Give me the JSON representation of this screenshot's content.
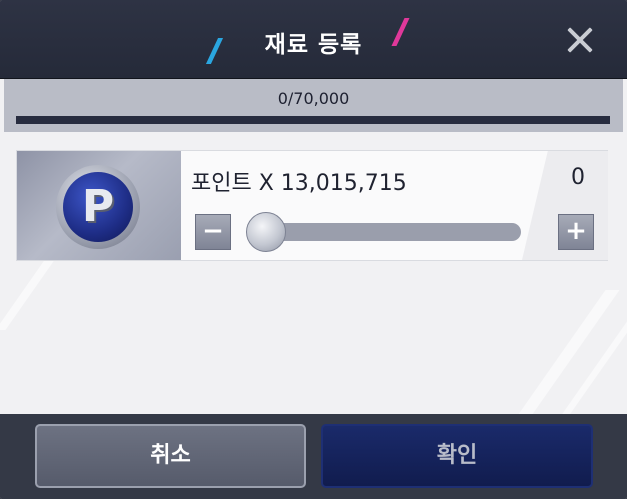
{
  "dialog": {
    "title": "재료 등록",
    "close_icon": "close-icon"
  },
  "capacity": {
    "count_text": "0/70,000",
    "fill": 0
  },
  "item": {
    "icon": "point-coin-icon",
    "icon_letter": "P",
    "name": "포인트 X 13,015,715",
    "quantity": "0",
    "minus_label": "−",
    "plus_label": "+",
    "slider_value": 0
  },
  "footer": {
    "cancel_label": "취소",
    "confirm_label": "확인"
  },
  "colors": {
    "accent_blue": "#2aa6e0",
    "accent_pink": "#e0389a",
    "confirm_bg": "#111c4e"
  }
}
